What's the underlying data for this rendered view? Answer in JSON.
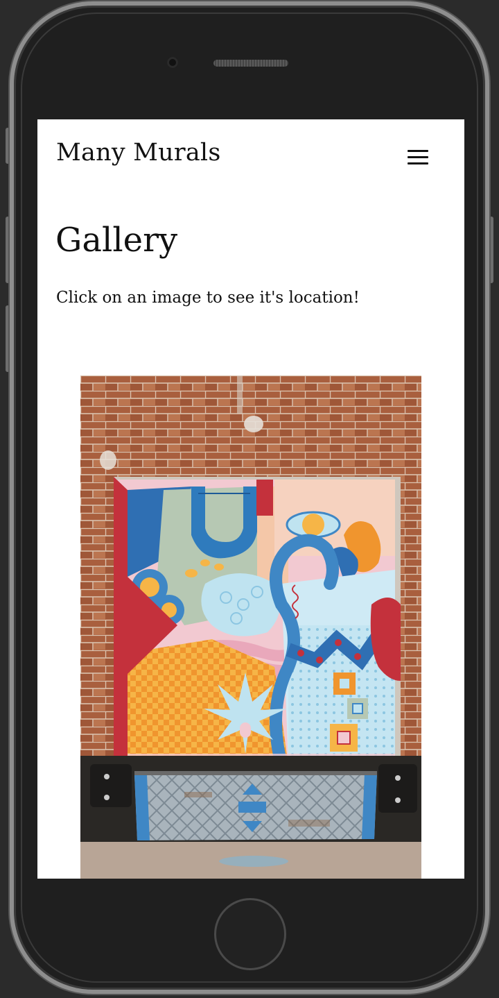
{
  "header": {
    "site_title": "Many Murals",
    "menu_icon": "hamburger-menu-icon"
  },
  "main": {
    "heading": "Gallery",
    "intro": "Click on an image to see it's location!"
  },
  "gallery": {
    "items": [
      {
        "alt": "Colorful abstract mural on a loading dock door set in a brick wall"
      }
    ]
  },
  "colors": {
    "brick": "#a5603f",
    "mural_orange": "#f0952e",
    "mural_blue": "#3f87c5",
    "mural_light_blue": "#bfe3f0",
    "mural_red": "#c4313c",
    "mural_pink": "#f2c9d1",
    "mural_sage": "#b6c8b3"
  }
}
